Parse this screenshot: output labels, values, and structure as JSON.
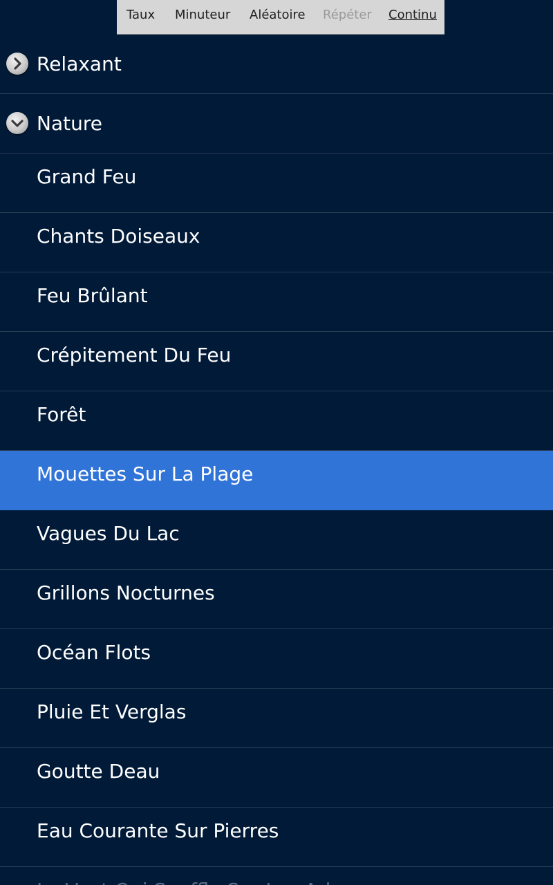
{
  "toolbar": {
    "rate": "Taux",
    "timer": "Minuteur",
    "shuffle": "Aléatoire",
    "repeat": "Répéter",
    "continuous": "Continu"
  },
  "groups": [
    {
      "label": "Relaxant",
      "icon": "chevron-right-icon",
      "expanded": false
    },
    {
      "label": "Nature",
      "icon": "chevron-down-icon",
      "expanded": true
    }
  ],
  "sounds": [
    "Grand Feu",
    "Chants Doiseaux",
    "Feu Brûlant",
    "Crépitement Du Feu",
    "Forêt",
    "Mouettes Sur La Plage",
    "Vagues Du Lac",
    "Grillons Nocturnes",
    "Océan Flots",
    "Pluie Et Verglas",
    "Goutte Deau",
    "Eau Courante Sur Pierres",
    "Le Vent Qui Souffle Sur Les Arbres"
  ],
  "selected_sound": "Mouettes Sur La Plage",
  "colors": {
    "background": "#011a38",
    "selected": "#3174d8",
    "toolbar": "#d6d6d6"
  }
}
